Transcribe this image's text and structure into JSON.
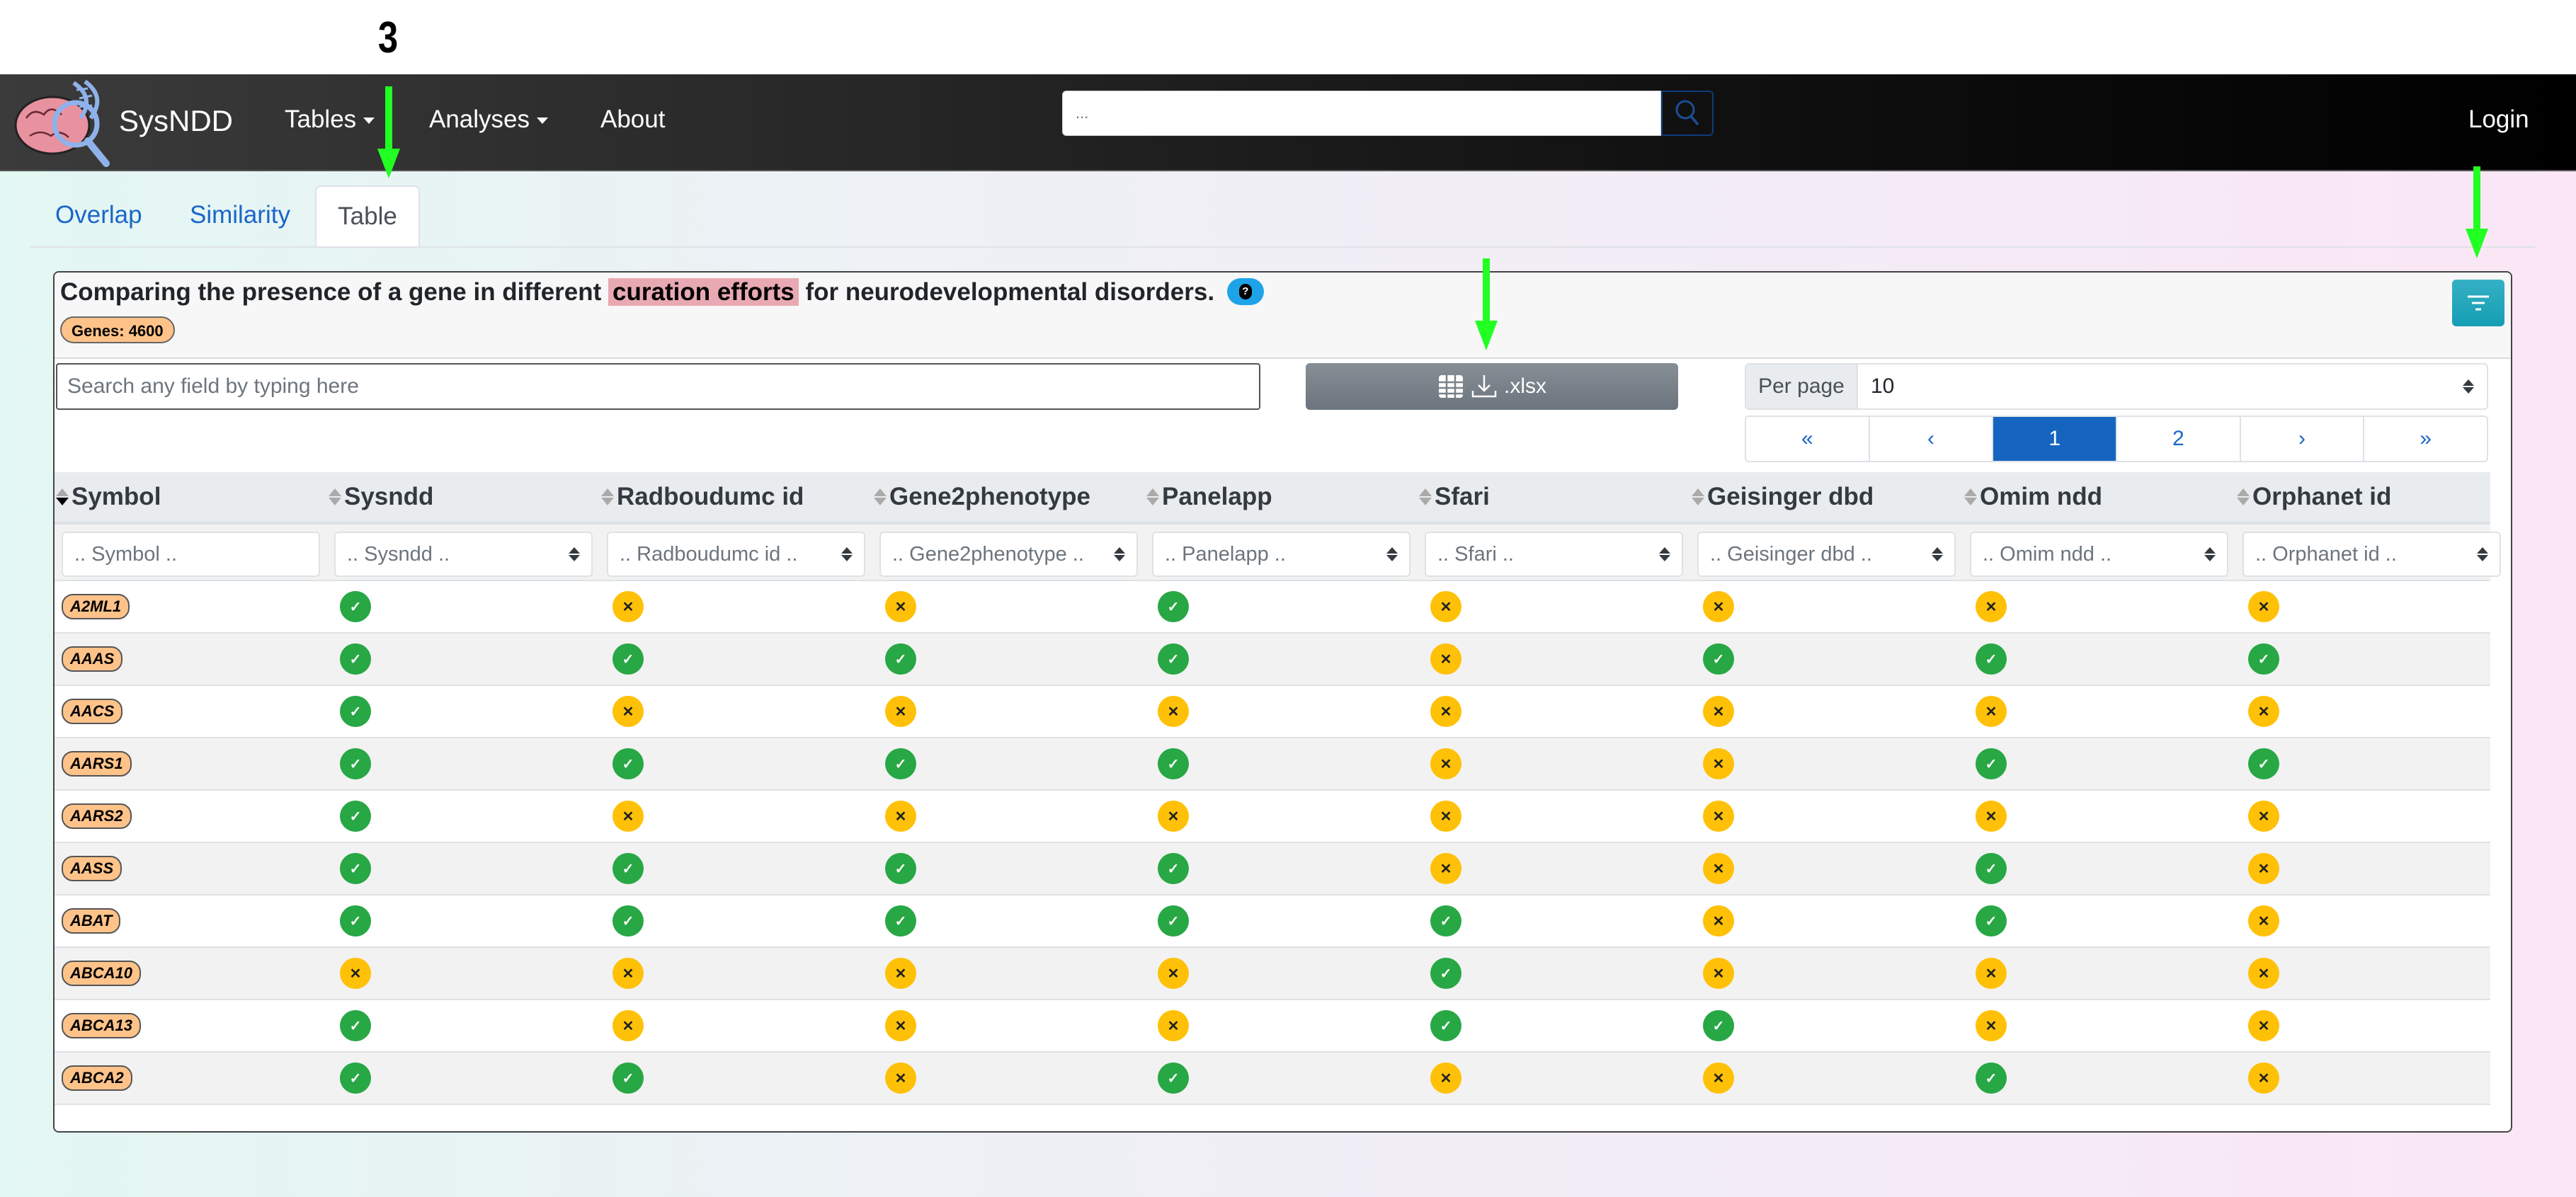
{
  "annotation": {
    "step_label": "3"
  },
  "navbar": {
    "brand": "SysNDD",
    "menu": [
      {
        "label": "Tables",
        "dropdown": true
      },
      {
        "label": "Analyses",
        "dropdown": true
      },
      {
        "label": "About",
        "dropdown": false
      }
    ],
    "search_placeholder": "...",
    "login_label": "Login"
  },
  "tabs": [
    {
      "label": "Overlap",
      "active": false
    },
    {
      "label": "Similarity",
      "active": false
    },
    {
      "label": "Table",
      "active": true
    }
  ],
  "card": {
    "title_before": "Comparing the presence of a gene in different ",
    "title_highlight": "curation efforts",
    "title_after": " for neurodevelopmental disorders.",
    "help_icon_label": "?",
    "genes_badge": "Genes: 4600",
    "search_placeholder": "Search any field by typing here",
    "xlsx_label": ".xlsx",
    "per_page_label": "Per page",
    "per_page_value": "10",
    "pagination": [
      {
        "label": "«",
        "active": false
      },
      {
        "label": "‹",
        "active": false
      },
      {
        "label": "1",
        "active": true
      },
      {
        "label": "2",
        "active": false
      },
      {
        "label": "›",
        "active": false
      },
      {
        "label": "»",
        "active": false
      }
    ]
  },
  "table": {
    "columns": [
      {
        "key": "symbol",
        "label": "Symbol",
        "filter": ".. Symbol ..",
        "filter_type": "input",
        "sorted": "desc"
      },
      {
        "key": "sysndd",
        "label": "Sysndd",
        "filter": ".. Sysndd ..",
        "filter_type": "select"
      },
      {
        "key": "radboudumc_id",
        "label": "Radboudumc id",
        "filter": ".. Radboudumc id ..",
        "filter_type": "select"
      },
      {
        "key": "gene2phenotype",
        "label": "Gene2phenotype",
        "filter": ".. Gene2phenotype ..",
        "filter_type": "select"
      },
      {
        "key": "panelapp",
        "label": "Panelapp",
        "filter": ".. Panelapp ..",
        "filter_type": "select"
      },
      {
        "key": "sfari",
        "label": "Sfari",
        "filter": ".. Sfari ..",
        "filter_type": "select"
      },
      {
        "key": "geisinger_dbd",
        "label": "Geisinger dbd",
        "filter": ".. Geisinger dbd ..",
        "filter_type": "select"
      },
      {
        "key": "omim_ndd",
        "label": "Omim ndd",
        "filter": ".. Omim ndd ..",
        "filter_type": "select"
      },
      {
        "key": "orphanet_id",
        "label": "Orphanet id",
        "filter": ".. Orphanet id ..",
        "filter_type": "select"
      }
    ],
    "status_icons": {
      "yes": "✓",
      "no": "✕"
    },
    "rows": [
      {
        "symbol": "A2ML1",
        "values": [
          "yes",
          "no",
          "no",
          "yes",
          "no",
          "no",
          "no",
          "no"
        ]
      },
      {
        "symbol": "AAAS",
        "values": [
          "yes",
          "yes",
          "yes",
          "yes",
          "no",
          "yes",
          "yes",
          "yes"
        ]
      },
      {
        "symbol": "AACS",
        "values": [
          "yes",
          "no",
          "no",
          "no",
          "no",
          "no",
          "no",
          "no"
        ]
      },
      {
        "symbol": "AARS1",
        "values": [
          "yes",
          "yes",
          "yes",
          "yes",
          "no",
          "no",
          "yes",
          "yes"
        ]
      },
      {
        "symbol": "AARS2",
        "values": [
          "yes",
          "no",
          "no",
          "no",
          "no",
          "no",
          "no",
          "no"
        ]
      },
      {
        "symbol": "AASS",
        "values": [
          "yes",
          "yes",
          "yes",
          "yes",
          "no",
          "no",
          "yes",
          "no"
        ]
      },
      {
        "symbol": "ABAT",
        "values": [
          "yes",
          "yes",
          "yes",
          "yes",
          "yes",
          "no",
          "yes",
          "no"
        ]
      },
      {
        "symbol": "ABCA10",
        "values": [
          "no",
          "no",
          "no",
          "no",
          "yes",
          "no",
          "no",
          "no"
        ]
      },
      {
        "symbol": "ABCA13",
        "values": [
          "yes",
          "no",
          "no",
          "no",
          "yes",
          "yes",
          "no",
          "no"
        ]
      },
      {
        "symbol": "ABCA2",
        "values": [
          "yes",
          "yes",
          "no",
          "yes",
          "no",
          "no",
          "yes",
          "no"
        ]
      }
    ]
  },
  "colors": {
    "yes": "#28a745",
    "no": "#ffc107",
    "gene_badge": "#ffc38a",
    "active_page": "#1565c0",
    "filter_button": "#17a2b8",
    "annotation_arrow": "#22ff22"
  }
}
